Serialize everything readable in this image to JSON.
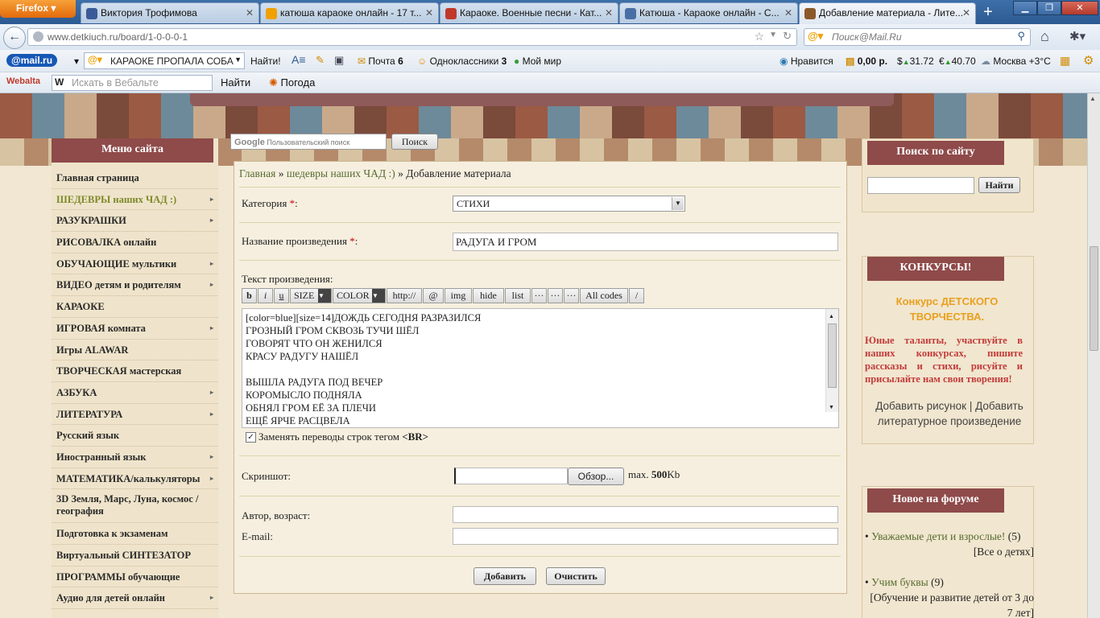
{
  "browser": {
    "app_button": "Firefox",
    "tabs": [
      {
        "title": "Виктория Трофимова",
        "favicon_color": "#3b5b98"
      },
      {
        "title": "катюша караоке онлайн - 17 т...",
        "favicon_color": "#f0a000"
      },
      {
        "title": "Караоке. Военные песни - Кат...",
        "favicon_color": "#c0392b"
      },
      {
        "title": "Катюша - Караоке онлайн - С...",
        "favicon_color": "#4a6fa5"
      },
      {
        "title": "Добавление материала - Лите...",
        "favicon_color": "#8b5a2b"
      }
    ],
    "new_tab": "+",
    "url": "www.detkiuch.ru/board/1-0-0-0-1",
    "search_placeholder": "Поиск@Mail.Ru"
  },
  "toolbar1": {
    "mailru_logo": "@mail.ru",
    "search_value": "КАРАОКЕ ПРОПАЛА СОБА",
    "find_button": "Найти!",
    "mail": "Почта",
    "mail_count": "6",
    "odnoklassniki": "Одноклассники",
    "ok_count": "3",
    "moi_mir": "Мой мир",
    "nravitsya": "Нравится",
    "balance": "0,00 р.",
    "usd": "31.72",
    "eur": "40.70",
    "weather": "Москва +3°C"
  },
  "toolbar2": {
    "webalta_logo": "Webalta",
    "search_placeholder": "Искать в Вебальте",
    "find_button": "Найти",
    "weather_label": "Погода"
  },
  "site": {
    "google_search_placeholder": "Пользовательский поиск",
    "google_search_button": "Поиск",
    "left_menu_title": "Меню сайта",
    "left_menu": [
      {
        "label": "Главная страница",
        "arrow": false,
        "highlight": false
      },
      {
        "label": "ШЕДЕВРЫ наших ЧАД :)",
        "arrow": true,
        "highlight": true
      },
      {
        "label": "РАЗУКРАШКИ",
        "arrow": true,
        "highlight": false
      },
      {
        "label": "РИСОВАЛКА онлайн",
        "arrow": false,
        "highlight": false
      },
      {
        "label": "ОБУЧАЮЩИЕ мультики",
        "arrow": true,
        "highlight": false
      },
      {
        "label": "ВИДЕО детям и родителям",
        "arrow": true,
        "highlight": false
      },
      {
        "label": "КАРАОКЕ",
        "arrow": false,
        "highlight": false
      },
      {
        "label": "ИГРОВАЯ комната",
        "arrow": true,
        "highlight": false
      },
      {
        "label": "Игры ALAWAR",
        "arrow": false,
        "highlight": false
      },
      {
        "label": "ТВОРЧЕСКАЯ мастерская",
        "arrow": false,
        "highlight": false
      },
      {
        "label": "АЗБУКА",
        "arrow": true,
        "highlight": false
      },
      {
        "label": "ЛИТЕРАТУРА",
        "arrow": true,
        "highlight": false
      },
      {
        "label": "Русский язык",
        "arrow": false,
        "highlight": false
      },
      {
        "label": "Иностранный язык",
        "arrow": true,
        "highlight": false
      },
      {
        "label": "МАТЕМАТИКА/калькуляторы",
        "arrow": true,
        "highlight": false
      },
      {
        "label": "3D Земля, Марс, Луна, космос / география",
        "arrow": false,
        "highlight": false
      },
      {
        "label": "Подготовка к экзаменам",
        "arrow": false,
        "highlight": false
      },
      {
        "label": "Виртуальный СИНТЕЗАТОР",
        "arrow": false,
        "highlight": false
      },
      {
        "label": "ПРОГРАММЫ обучающие",
        "arrow": false,
        "highlight": false
      },
      {
        "label": "Аудио для детей онлайн",
        "arrow": true,
        "highlight": false
      }
    ],
    "breadcrumb": {
      "home": "Главная",
      "sep": "»",
      "section": "шедевры наших ЧАД :)",
      "current": "Добавление материала"
    },
    "form": {
      "category_label": "Категория",
      "category_value": "СТИХИ",
      "title_label": "Название произведения",
      "title_value": "РАДУГА И ГРОМ",
      "text_label": "Текст произведения:",
      "editor_buttons": [
        "b",
        "i",
        "u",
        "SIZE",
        "COLOR",
        "http://",
        "@",
        "img",
        "hide",
        "list",
        "···",
        "···",
        "···",
        "All codes",
        "/"
      ],
      "text_lines": [
        "[color=blue][size=14]ДОЖДЬ СЕГОДНЯ РАЗРАЗИЛСЯ",
        "ГРОЗНЫЙ ГРОМ СКВОЗЬ ТУЧИ ШЁЛ",
        "ГОВОРЯТ ЧТО ОН ЖЕНИЛСЯ",
        "КРАСУ РАДУГУ НАШЁЛ",
        "",
        "ВЫШЛА РАДУГА ПОД ВЕЧЕР",
        "КОРОМЫСЛО ПОДНЯЛА",
        "ОБНЯЛ ГРОМ ЕЁ ЗА ПЛЕЧИ",
        "ЕЩЁ ЯРЧЕ РАСЦВЕЛА"
      ],
      "br_checkbox_label": "Заменять переводы строк тегом",
      "br_tag": "<BR>",
      "screenshot_label": "Скриншот:",
      "browse_button": "Обзор...",
      "max_label": "max.",
      "max_value": "500",
      "max_unit": "Kb",
      "author_label": "Автор, возраст:",
      "email_label": "E-mail:",
      "submit_button": "Добавить",
      "clear_button": "Очистить"
    },
    "right": {
      "search_title": "Поиск по сайту",
      "search_button": "Найти",
      "contest_title": "КОНКУРСЫ!",
      "contest_heading": "Конкурс ДЕТСКОГО ТВОРЧЕСТВА.",
      "contest_text": "Юные таланты, участвуйте в наших конкурсах, пишите рассказы и стихи, рисуйте и присылайте нам свои творения!",
      "add_drawing": "Добавить рисунок",
      "link_sep": "|",
      "add_literary": "Добавить литературное произведение",
      "forum_title": "Новое на форуме",
      "forum_items": [
        {
          "title": "Уважаемые дети и взрослые!",
          "count": "(5)",
          "section": "[Все о детях]"
        },
        {
          "title": "Учим буквы",
          "count": "(9)",
          "section": "[Обучение и развитие детей от 3 до 7 лет]"
        }
      ]
    },
    "colors": {
      "menu_header": "#8f4a4a",
      "accent_link": "#7d8a2a",
      "contest_orange": "#e8a020",
      "contest_red": "#c23b3b"
    }
  }
}
